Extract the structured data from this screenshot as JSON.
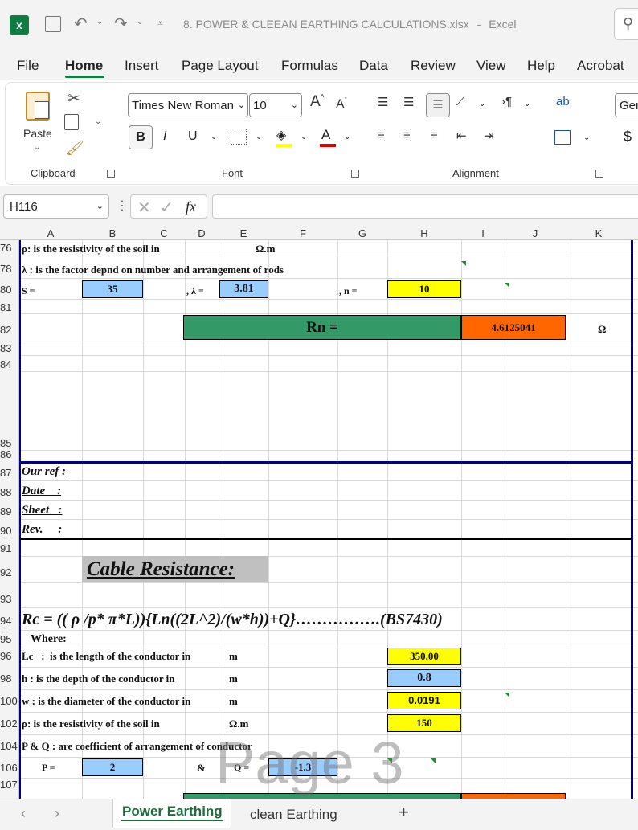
{
  "app": {
    "filename": "8. POWER & CLEEAN EARTHING CALCULATIONS.xlsx",
    "sep": "-",
    "app_name": "Excel"
  },
  "tabs": [
    "File",
    "Home",
    "Insert",
    "Page Layout",
    "Formulas",
    "Data",
    "Review",
    "View",
    "Help",
    "Acrobat"
  ],
  "ribbon": {
    "font_name": "Times New Roman",
    "font_size": "10",
    "number_format": "Gen",
    "paste_label": "Paste",
    "bold": "B",
    "italic": "I",
    "underline": "U",
    "groups": {
      "clipboard": "Clipboard",
      "font": "Font",
      "alignment": "Alignment"
    }
  },
  "formula_bar": {
    "name_box": "H116",
    "fx": "fx",
    "formula": ""
  },
  "colors": {
    "green": "#339966",
    "orange": "#ff6600",
    "blue": "#99ccff",
    "yellow": "#ffff00",
    "navy": "#000080",
    "gray": "#c0c0c0"
  },
  "columns": [
    "A",
    "B",
    "C",
    "D",
    "E",
    "F",
    "G",
    "H",
    "I",
    "J",
    "K"
  ],
  "row_numbers": [
    "76",
    "78",
    "80",
    "81",
    "82",
    "83",
    "84",
    "85",
    "86",
    "87",
    "88",
    "89",
    "90",
    "91",
    "92",
    "93",
    "94",
    "95",
    "96",
    "98",
    "100",
    "102",
    "104",
    "106",
    "107"
  ],
  "cells": {
    "r76": "ρ: is the resistivity of the soil in",
    "r76_unit": "Ω.m",
    "r78": "λ : is the factor depnd on number and arrangement of rods",
    "r80_s": "S =",
    "r80_s_val": "35",
    "r80_l": ", λ =",
    "r80_l_val": "3.81",
    "r80_n": ", n =",
    "r80_n_val": "10",
    "r82_label": "Rn =",
    "r82_val": "4.6125041",
    "r82_unit": "Ω",
    "ref": "Our ref :",
    "date": "Date    :",
    "sheet": "Sheet   :",
    "rev": "Rev.     :",
    "cable_title": "Cable Resistance:",
    "formula": "Rc = (( ρ /p* π*L)){Ln((2L^2)/(w*h))+Q}…………….(BS7430)",
    "where": "Where:",
    "lc": "Lc   :  is the length of the conductor in",
    "lc_unit": "m",
    "lc_val": "350.00",
    "h": "h  : is the depth of the conductor in",
    "h_unit": "m",
    "h_val": "0.8",
    "w": "w  : is the diameter of the conductor in",
    "w_unit": "m",
    "w_val": "0.0191",
    "rho": "ρ: is the resistivity of the soil in",
    "rho_unit": "Ω.m",
    "rho_val": "150",
    "pq": "P & Q  : are coefficient of arrangement of conductor",
    "p": "P =",
    "p_val": "2",
    "amp": "&",
    "q": "Q =",
    "q_val": "-1.3"
  },
  "watermark": "Page 3",
  "sheets": [
    "Power Earthing",
    "clean Earthing"
  ],
  "add_sheet": "+"
}
